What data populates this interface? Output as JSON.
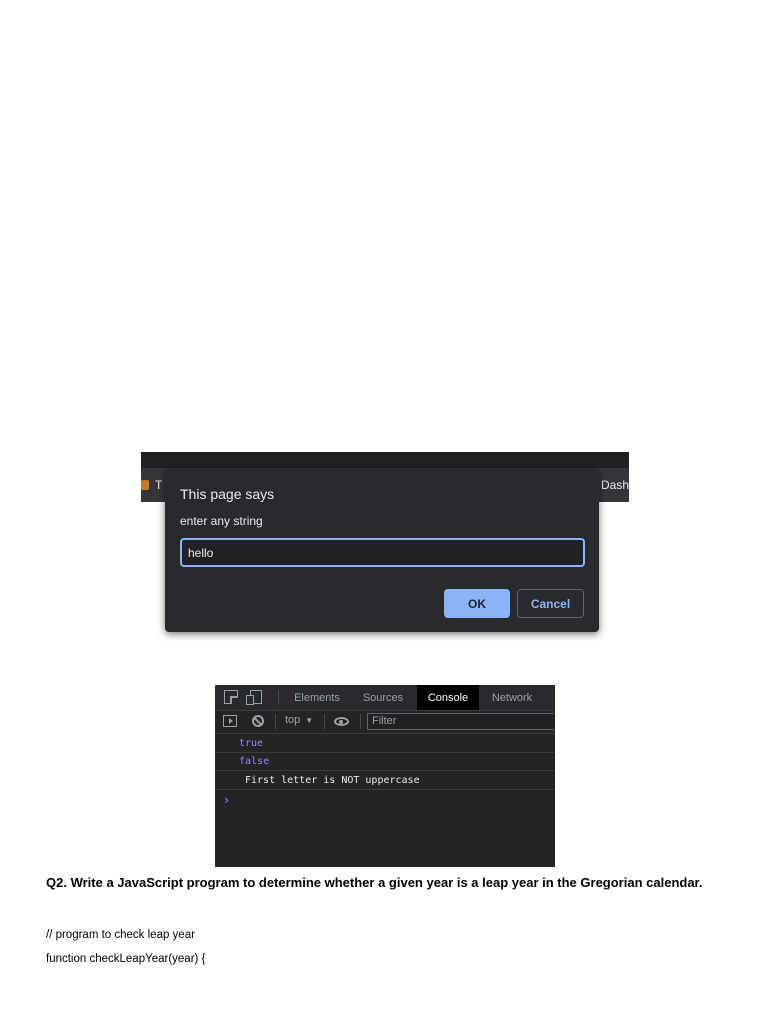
{
  "prompt_screenshot": {
    "tab_fragment_left": "T",
    "tab_fragment_right": "Dash",
    "dialog": {
      "title": "This page says",
      "message": "enter any string",
      "input_value": "hello",
      "ok_label": "OK",
      "cancel_label": "Cancel"
    }
  },
  "devtools": {
    "tabs": [
      {
        "label": "Elements",
        "active": false
      },
      {
        "label": "Sources",
        "active": false
      },
      {
        "label": "Console",
        "active": true
      },
      {
        "label": "Network",
        "active": false
      }
    ],
    "context_label": "top",
    "context_caret": "▼",
    "filter_placeholder": "Filter",
    "console_lines": [
      {
        "text": "true",
        "kind": "value"
      },
      {
        "text": "false",
        "kind": "value"
      },
      {
        "text": "First letter is NOT uppercase",
        "kind": "log"
      }
    ],
    "prompt_symbol": "›",
    "colors": {
      "value": "#9980ff",
      "prompt": "#4a9eff",
      "active_tab_bg": "#000000"
    }
  },
  "document": {
    "question": "Q2. Write a JavaScript program to determine whether a given year is a leap year in the Gregorian calendar.",
    "code_lines": [
      "// program to check leap year",
      "function checkLeapYear(year) {"
    ]
  }
}
